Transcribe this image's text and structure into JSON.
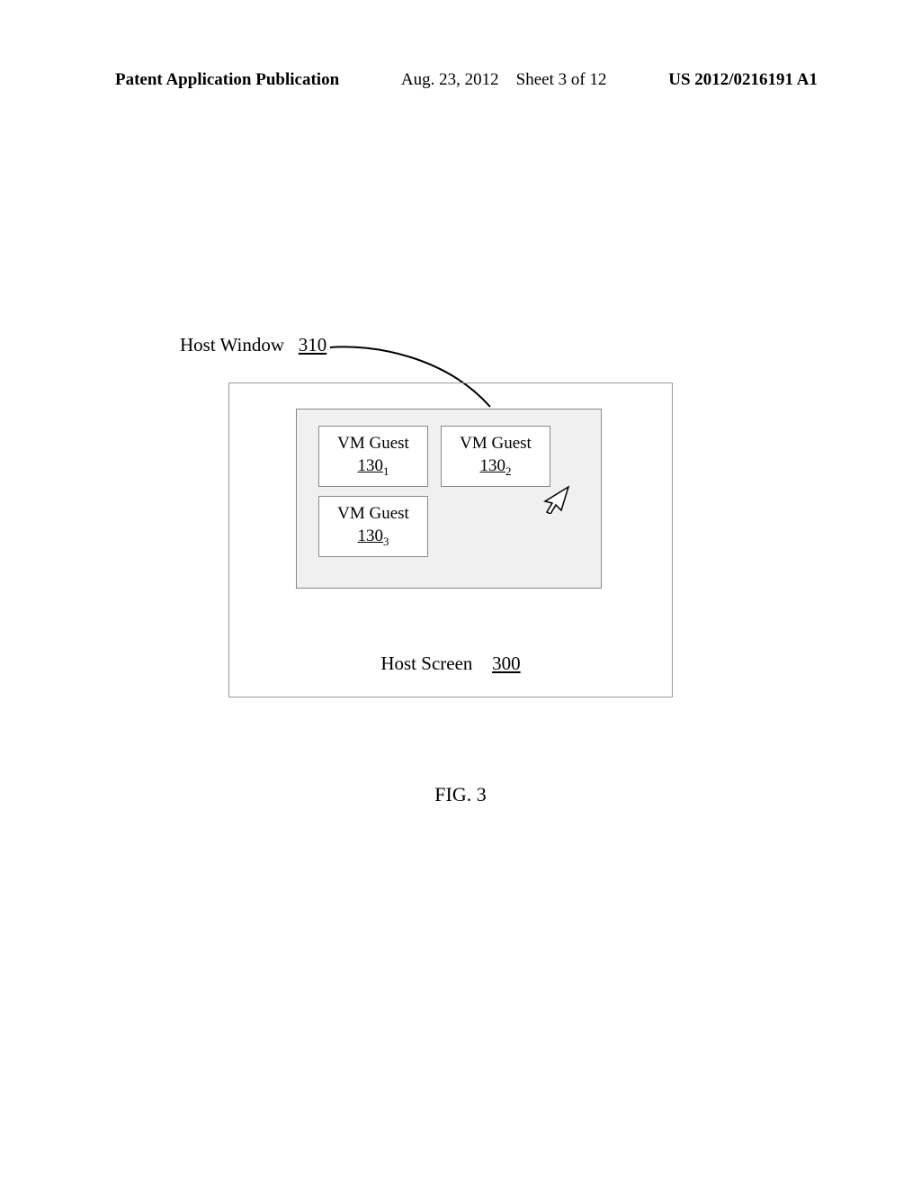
{
  "header": {
    "left": "Patent Application Publication",
    "date": "Aug. 23, 2012",
    "sheet": "Sheet 3 of 12",
    "pubno": "US 2012/0216191 A1"
  },
  "diagram": {
    "host_window_label": "Host Window",
    "host_window_ref": "310",
    "vm_guest_title": "VM Guest",
    "vm_guest_ref": "130",
    "vm_guest_sub1": "1",
    "vm_guest_sub2": "2",
    "vm_guest_sub3": "3",
    "host_screen_label": "Host Screen",
    "host_screen_ref": "300"
  },
  "figure_label": "FIG. 3"
}
